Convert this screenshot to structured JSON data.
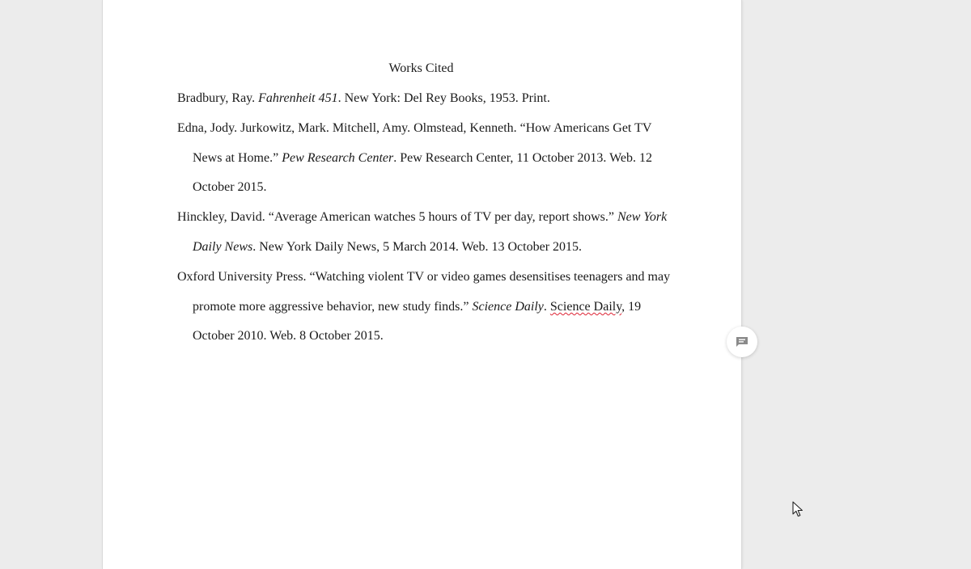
{
  "document": {
    "title": "Works Cited",
    "entries": [
      {
        "lines": [
          {
            "a": "Bradbury, Ray. ",
            "i": "Fahrenheit 451",
            "b": ". New York: Del Rey Books, 1953. Print."
          }
        ]
      },
      {
        "lines": [
          {
            "a": "Edna, Jody. Jurkowitz, Mark. Mitchell, Amy. Olmstead, Kenneth. “How Americans Get TV",
            "i": "",
            "b": ""
          },
          {
            "a": "News at Home.” ",
            "i": "Pew Research Center",
            "b": ". Pew Research Center, 11 October 2013. Web. 12"
          },
          {
            "a": "October 2015.",
            "i": "",
            "b": ""
          }
        ]
      },
      {
        "lines": [
          {
            "a": "Hinckley, David. “Average American watches 5 hours of TV per day, report shows.” ",
            "i": "New York",
            "b": ""
          },
          {
            "a": "",
            "i": "Daily News",
            "b": ". New York Daily News, 5 March 2014. Web. 13 October 2015."
          }
        ]
      },
      {
        "lines": [
          {
            "a": "Oxford University Press. “Watching violent TV or video games desensitises teenagers and may",
            "i": "",
            "b": ""
          },
          {
            "a": "promote more aggressive behavior, new study finds.” ",
            "i": "Science Daily",
            "b": ". ",
            "s": "Science Daily",
            "c": ", 19"
          },
          {
            "a": "October 2010. Web. 8 October 2015.",
            "i": "",
            "b": ""
          }
        ]
      }
    ]
  },
  "side": {
    "comment_icon": "comment-icon"
  },
  "colors": {
    "background": "#ececec",
    "page": "#ffffff",
    "spellcheck": "#dd2233"
  }
}
